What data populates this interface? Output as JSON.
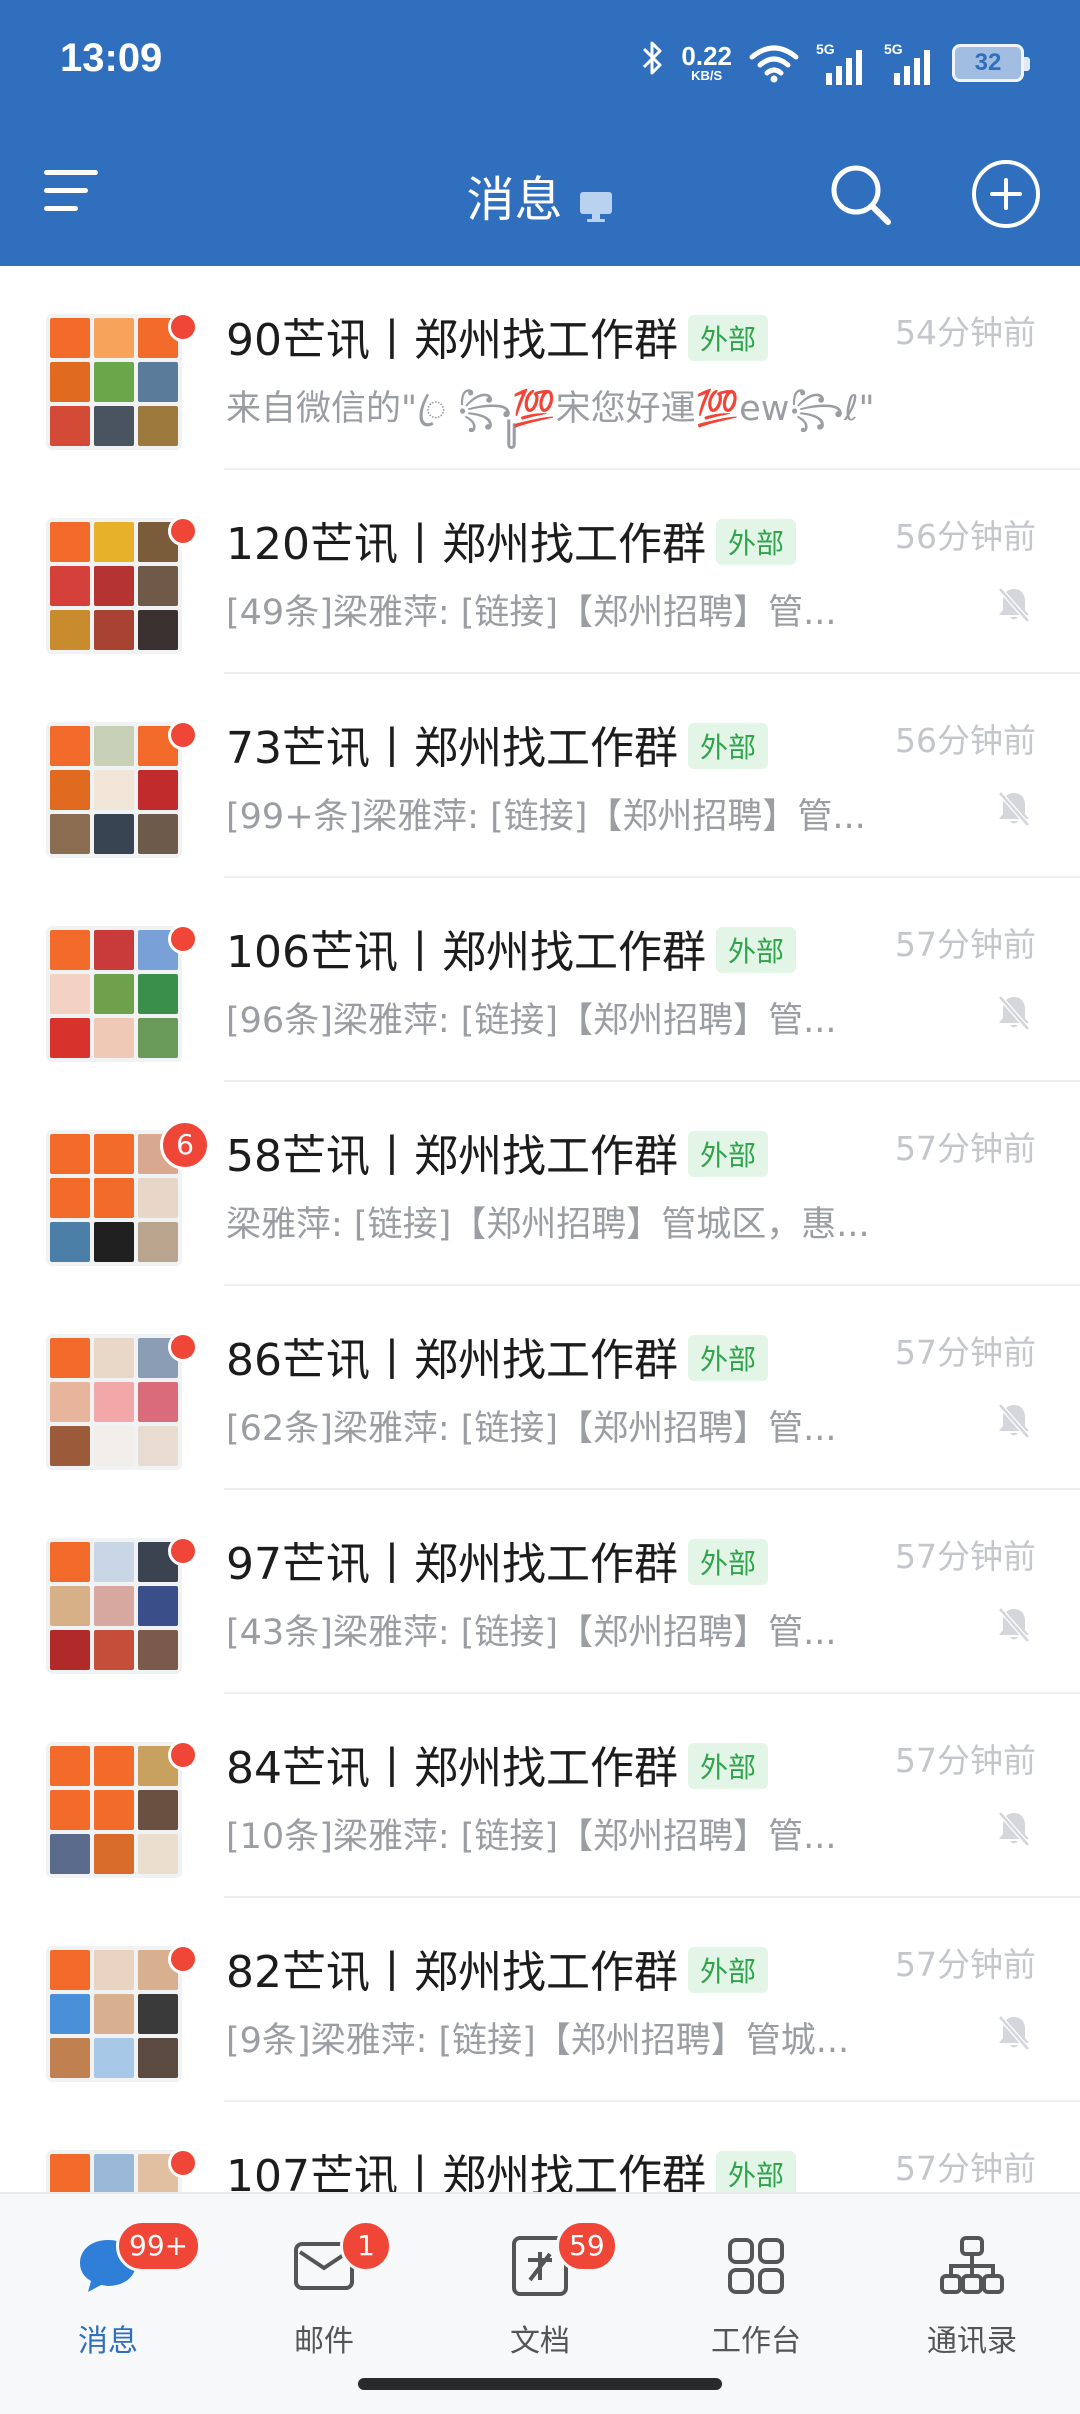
{
  "status_bar": {
    "time": "13:09",
    "speed_value": "0.22",
    "speed_unit": "KB/S",
    "net1": "5G",
    "net2": "5G",
    "battery": "32"
  },
  "header": {
    "title": "消息",
    "accent_color": "#2f6fbe"
  },
  "conversations": [
    {
      "name": "90芒讯丨郑州找工作群",
      "tag": "外部",
      "time": "54分钟前",
      "preview": "来自微信的\"ꦿ ꧂ꦸ💯宋您好運💯ew꧂ℓ\"",
      "badge": "",
      "muted": false
    },
    {
      "name": "120芒讯丨郑州找工作群",
      "tag": "外部",
      "time": "56分钟前",
      "preview": "[49条]梁雅萍: [链接]【郑州招聘】管...",
      "badge": "",
      "muted": true
    },
    {
      "name": "73芒讯丨郑州找工作群",
      "tag": "外部",
      "time": "56分钟前",
      "preview": "[99+条]梁雅萍: [链接]【郑州招聘】管...",
      "badge": "",
      "muted": true
    },
    {
      "name": "106芒讯丨郑州找工作群",
      "tag": "外部",
      "time": "57分钟前",
      "preview": "[96条]梁雅萍: [链接]【郑州招聘】管...",
      "badge": "",
      "muted": true
    },
    {
      "name": "58芒讯丨郑州找工作群",
      "tag": "外部",
      "time": "57分钟前",
      "preview": "梁雅萍: [链接]【郑州招聘】管城区，惠...",
      "badge": "6",
      "muted": false
    },
    {
      "name": "86芒讯丨郑州找工作群",
      "tag": "外部",
      "time": "57分钟前",
      "preview": "[62条]梁雅萍: [链接]【郑州招聘】管...",
      "badge": "",
      "muted": true
    },
    {
      "name": "97芒讯丨郑州找工作群",
      "tag": "外部",
      "time": "57分钟前",
      "preview": "[43条]梁雅萍: [链接]【郑州招聘】管...",
      "badge": "",
      "muted": true
    },
    {
      "name": "84芒讯丨郑州找工作群",
      "tag": "外部",
      "time": "57分钟前",
      "preview": "[10条]梁雅萍: [链接]【郑州招聘】管...",
      "badge": "",
      "muted": true
    },
    {
      "name": "82芒讯丨郑州找工作群",
      "tag": "外部",
      "time": "57分钟前",
      "preview": "[9条]梁雅萍: [链接]【郑州招聘】管城...",
      "badge": "",
      "muted": true
    },
    {
      "name": "107芒讯丨郑州找工作群",
      "tag": "外部",
      "time": "57分钟前",
      "preview": "",
      "badge": "",
      "muted": true
    }
  ],
  "tabs": [
    {
      "label": "消息",
      "badge": "99+",
      "icon": "chat-bubble-icon",
      "active": true
    },
    {
      "label": "邮件",
      "badge": "1",
      "icon": "mail-icon",
      "active": false
    },
    {
      "label": "文档",
      "badge": "59",
      "icon": "document-icon",
      "active": false
    },
    {
      "label": "工作台",
      "badge": "",
      "icon": "grid-apps-icon",
      "active": false
    },
    {
      "label": "通讯录",
      "badge": "",
      "icon": "org-chart-icon",
      "active": false
    }
  ]
}
